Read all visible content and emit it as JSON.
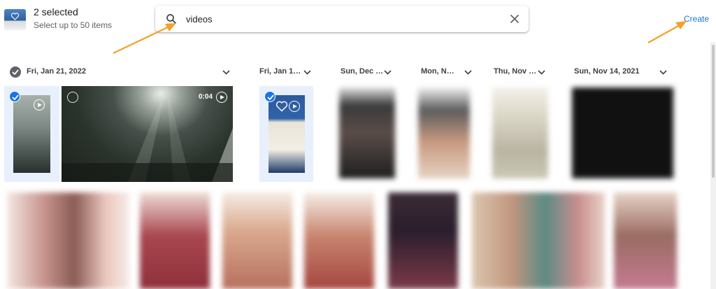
{
  "header": {
    "selected_title": "2 selected",
    "selected_subtitle": "Select up to 50 items",
    "search_value": "videos",
    "create_label": "Create"
  },
  "dates": [
    {
      "label": "Fri, Jan 21, 2022"
    },
    {
      "label": "Fri, Jan 1…"
    },
    {
      "label": "Sun, Dec …"
    },
    {
      "label": "Mon, N…"
    },
    {
      "label": "Thu, Nov …"
    },
    {
      "label": "Sun, Nov 14, 2021"
    }
  ],
  "media": {
    "video1_duration": "0:04"
  },
  "icons": [
    "search-icon",
    "close-icon",
    "chevron-down-icon",
    "check-circle-icon",
    "play-icon",
    "heart-icon"
  ],
  "colors": {
    "accent": "#1a73e8",
    "selected_bg": "#e8f0fe",
    "annotation_arrow": "#f4a12a"
  }
}
